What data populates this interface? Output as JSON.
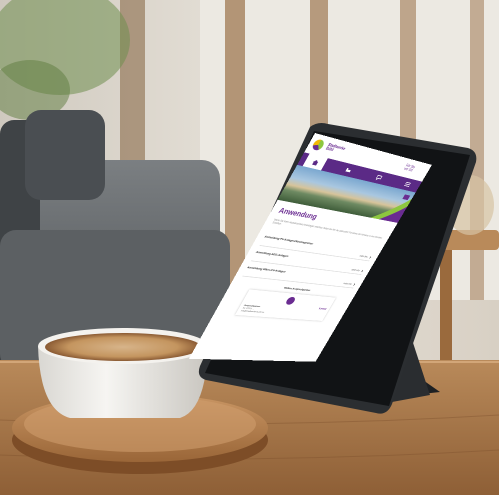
{
  "website": {
    "brand_line1": "Stadtwerke",
    "brand_line2": "Bühl",
    "slogan_line1": "Für Sie",
    "slogan_line2": "vor Ort",
    "nav_items": [
      {
        "icon": "home-icon"
      },
      {
        "icon": "water-icon"
      },
      {
        "icon": "chat-icon"
      },
      {
        "icon": "menu-icon"
      }
    ],
    "page_title": "Anwendung",
    "intro_text": "Wenn Sie Ihren Hausanschluss beantragen möchten, finden Sie hier die passenden Formulare und Hinweise zu den einzelnen Schritten.",
    "rows": [
      {
        "title": "Anmeldung PV-Anlagen/Stromspeicher",
        "action": "mehr Info"
      },
      {
        "title": "Anmeldung EEG-Anlagen",
        "action": "mehr Info"
      },
      {
        "title": "Anmeldung Mikro-PV-Anlagen",
        "action": "mehr Info"
      }
    ],
    "contact_heading": "Weitere Ansprechpartner",
    "contact_tag": "Kontakt",
    "contact_name": "Ansprechpartner",
    "contact_line1": "Tel. 07223 …",
    "contact_line2": "info@stadtwerke-buehl.de"
  },
  "colors": {
    "brand_purple": "#5b2a86",
    "brand_green": "#8dc63f",
    "brand_yellow": "#f2b705"
  }
}
